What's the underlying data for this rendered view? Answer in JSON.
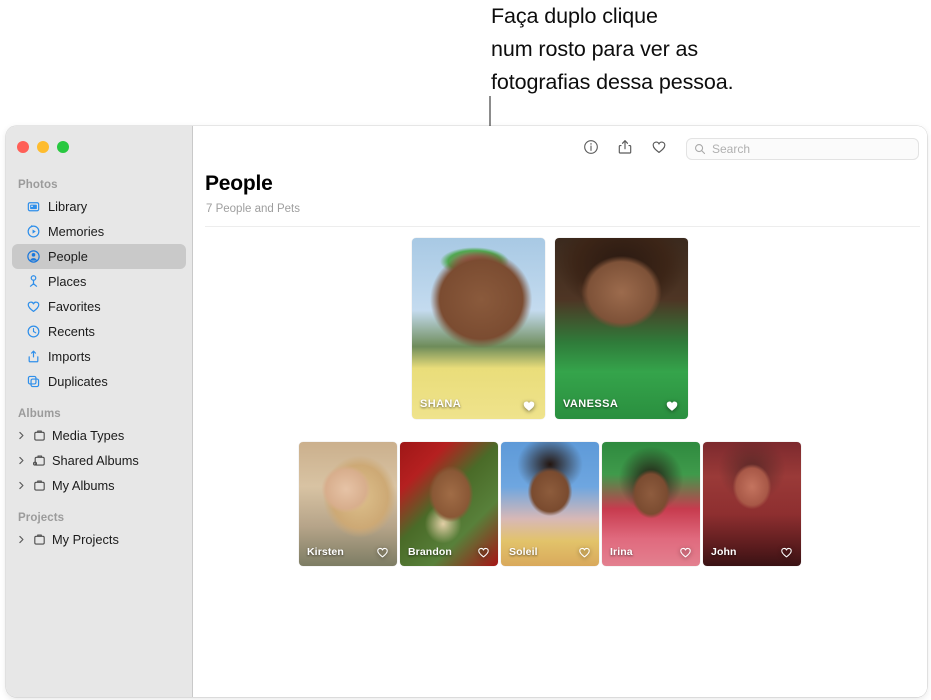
{
  "callout": {
    "lines": [
      "Faça duplo clique",
      "num rosto para ver as",
      "fotografias dessa pessoa."
    ]
  },
  "window": {
    "traffic_lights": [
      {
        "name": "close",
        "color": "#ff5f57"
      },
      {
        "name": "minimize",
        "color": "#febc2e"
      },
      {
        "name": "zoom",
        "color": "#28c840"
      }
    ]
  },
  "sidebar": {
    "groups": [
      {
        "header": "Photos",
        "items": [
          {
            "label": "Library",
            "icon": "library-icon",
            "selected": false
          },
          {
            "label": "Memories",
            "icon": "memories-icon",
            "selected": false
          },
          {
            "label": "People",
            "icon": "people-icon",
            "selected": true
          },
          {
            "label": "Places",
            "icon": "places-icon",
            "selected": false
          },
          {
            "label": "Favorites",
            "icon": "heart-icon",
            "selected": false
          },
          {
            "label": "Recents",
            "icon": "clock-icon",
            "selected": false
          },
          {
            "label": "Imports",
            "icon": "import-icon",
            "selected": false
          },
          {
            "label": "Duplicates",
            "icon": "duplicates-icon",
            "selected": false
          }
        ]
      },
      {
        "header": "Albums",
        "items": [
          {
            "label": "Media Types",
            "icon": "album-icon",
            "disclosure": true
          },
          {
            "label": "Shared Albums",
            "icon": "shared-album-icon",
            "disclosure": true
          },
          {
            "label": "My Albums",
            "icon": "album-icon",
            "disclosure": true
          }
        ]
      },
      {
        "header": "Projects",
        "items": [
          {
            "label": "My Projects",
            "icon": "album-icon",
            "disclosure": true
          }
        ]
      }
    ]
  },
  "toolbar": {
    "buttons": [
      {
        "name": "info-button",
        "icon": "info-icon"
      },
      {
        "name": "share-button",
        "icon": "share-icon"
      },
      {
        "name": "favorite-button",
        "icon": "heart-icon"
      }
    ],
    "search": {
      "placeholder": "Search",
      "value": "",
      "icon": "search-icon"
    }
  },
  "main": {
    "title": "People",
    "subtitle": "7 People and Pets",
    "people_large": [
      {
        "name": "SHANA",
        "favorited": true,
        "photo_class": "ph-shana"
      },
      {
        "name": "VANESSA",
        "favorited": true,
        "photo_class": "ph-vanessa"
      }
    ],
    "people_small": [
      {
        "name": "Kirsten",
        "favorited": false,
        "photo_class": "ph-kirsten"
      },
      {
        "name": "Brandon",
        "favorited": false,
        "photo_class": "ph-brandon"
      },
      {
        "name": "Soleil",
        "favorited": false,
        "photo_class": "ph-soleil"
      },
      {
        "name": "Irina",
        "favorited": false,
        "photo_class": "ph-irina"
      },
      {
        "name": "John",
        "favorited": false,
        "photo_class": "ph-john"
      }
    ]
  }
}
